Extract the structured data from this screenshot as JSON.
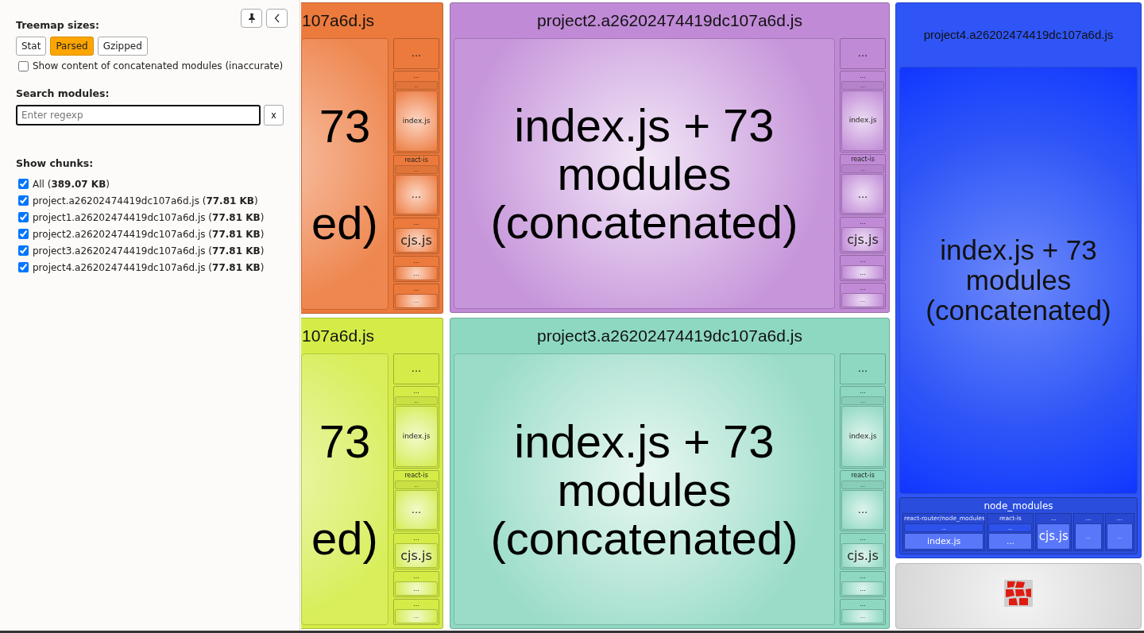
{
  "sidebar": {
    "sizes_label": "Treemap sizes:",
    "size_buttons": [
      {
        "label": "Stat",
        "selected": false
      },
      {
        "label": "Parsed",
        "selected": true
      },
      {
        "label": "Gzipped",
        "selected": false
      }
    ],
    "concat_option": {
      "label": "Show content of concatenated modules (inaccurate)",
      "checked": false
    },
    "search_label": "Search modules:",
    "search": {
      "placeholder": "Enter regexp",
      "clear": "x"
    },
    "chunks_label": "Show chunks:",
    "chunks": [
      {
        "label": "All (**389.07 KB**)",
        "checked": true
      },
      {
        "label": "project.a26202474419dc107a6d.js (**77.81 KB**)",
        "checked": true
      },
      {
        "label": "project1.a26202474419dc107a6d.js (**77.81 KB**)",
        "checked": true
      },
      {
        "label": "project2.a26202474419dc107a6d.js (**77.81 KB**)",
        "checked": true
      },
      {
        "label": "project3.a26202474419dc107a6d.js (**77.81 KB**)",
        "checked": true
      },
      {
        "label": "project4.a26202474419dc107a6d.js (**77.81 KB**)",
        "checked": true
      }
    ]
  },
  "treemap": [
    {
      "name": "107a6d.js",
      "color": "#ec7a3c",
      "kind": "cut-side-column",
      "main_parts": [
        "73",
        "ed)"
      ],
      "groups": [
        {
          "label": "..."
        },
        {
          "label": "...",
          "cells": [
            "...",
            "index.js"
          ]
        },
        {
          "label": "react-is",
          "cells": [
            "...",
            "..."
          ]
        },
        {
          "label": "...",
          "cells": [
            "cjs.js"
          ]
        },
        {
          "label": "...",
          "cells": [
            "..."
          ]
        },
        {
          "label": "...",
          "cells": [
            "..."
          ]
        }
      ]
    },
    {
      "name": "project2.a26202474419dc107a6d.js",
      "color": "#c08ad6",
      "kind": "side-column",
      "main": "index.js + 73 modules (concatenated)",
      "groups": [
        {
          "label": "..."
        },
        {
          "label": "...",
          "cells": [
            "...",
            "index.js"
          ]
        },
        {
          "label": "react-is",
          "cells": [
            "...",
            "..."
          ]
        },
        {
          "label": "...",
          "cells": [
            "cjs.js"
          ]
        },
        {
          "label": "...",
          "cells": [
            "..."
          ]
        },
        {
          "label": "...",
          "cells": [
            "..."
          ]
        }
      ]
    },
    {
      "name": "107a6d.js",
      "color": "#d5ec48",
      "kind": "cut-side-column",
      "main_parts": [
        "73",
        "ed)"
      ],
      "groups": [
        {
          "label": "..."
        },
        {
          "label": "...",
          "cells": [
            "...",
            "index.js"
          ]
        },
        {
          "label": "react-is",
          "cells": [
            "...",
            "..."
          ]
        },
        {
          "label": "...",
          "cells": [
            "cjs.js"
          ]
        },
        {
          "label": "...",
          "cells": [
            "..."
          ]
        },
        {
          "label": "...",
          "cells": [
            "..."
          ]
        }
      ]
    },
    {
      "name": "project3.a26202474419dc107a6d.js",
      "color": "#8ed8c2",
      "kind": "side-column",
      "main": "index.js + 73 modules (concatenated)",
      "groups": [
        {
          "label": "..."
        },
        {
          "label": "...",
          "cells": [
            "...",
            "index.js"
          ]
        },
        {
          "label": "react-is",
          "cells": [
            "...",
            "..."
          ]
        },
        {
          "label": "...",
          "cells": [
            "cjs.js"
          ]
        },
        {
          "label": "...",
          "cells": [
            "..."
          ]
        },
        {
          "label": "...",
          "cells": [
            "..."
          ]
        }
      ]
    },
    {
      "name": "project4.a26202474419dc107a6d.js",
      "color": "#2f55f7",
      "kind": "bottom-row",
      "main": "index.js + 73 modules (concatenated)",
      "folder": {
        "label": "node_modules",
        "groups": [
          {
            "label": "react-router/node_modules",
            "cells": [
              "...",
              "index.js"
            ]
          },
          {
            "label": "react-is",
            "cells": [
              "...",
              "..."
            ]
          },
          {
            "label": "...",
            "cells": [
              "cjs.js"
            ]
          },
          {
            "label": "...",
            "cells": [
              "..."
            ]
          },
          {
            "label": "...",
            "cells": [
              "..."
            ]
          }
        ]
      }
    }
  ]
}
